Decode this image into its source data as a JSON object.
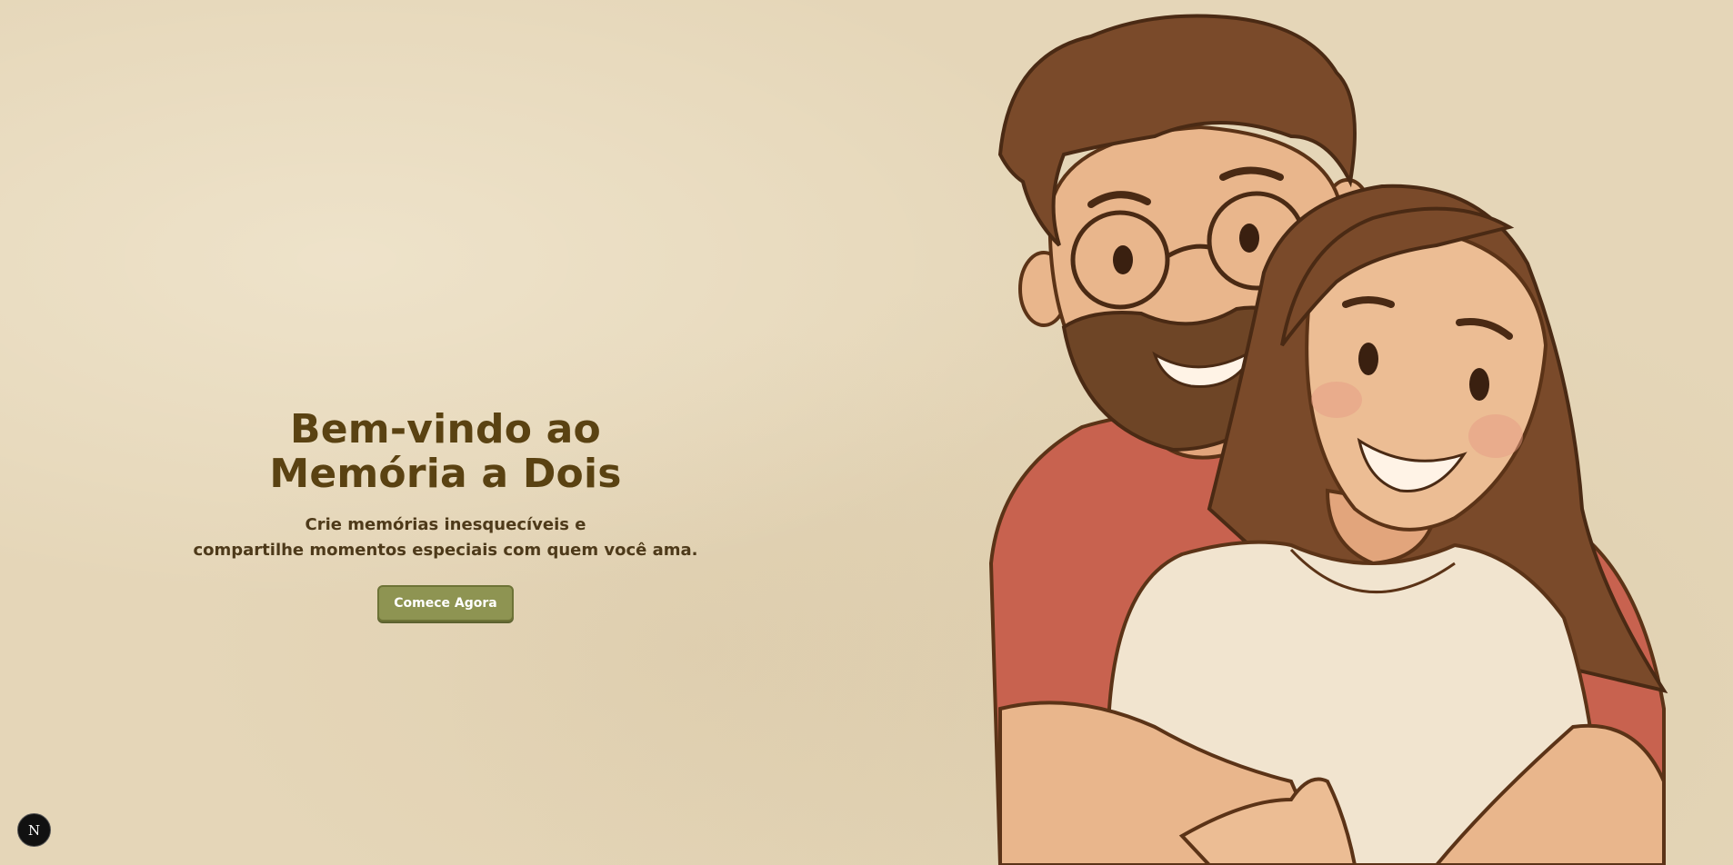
{
  "hero": {
    "title_line1": "Bem-vindo ao",
    "title_line2": "Memória a Dois",
    "subtitle_line1": "Crie memórias inesquecíveis e",
    "subtitle_line2": "compartilhe momentos especiais com quem você ama.",
    "cta_label": "Comece Agora"
  },
  "illustration": {
    "icon": "couple-illustration-icon"
  },
  "dev_badge": {
    "icon": "nextjs-logo-icon",
    "label": "N"
  },
  "colors": {
    "background": "#e5d6b8",
    "title": "#5a4212",
    "button": "#8e9452",
    "shirt_man": "#c8624f",
    "shirt_woman": "#f1e4cf",
    "hair": "#7a4a2a",
    "skin": "#e9b68c"
  }
}
